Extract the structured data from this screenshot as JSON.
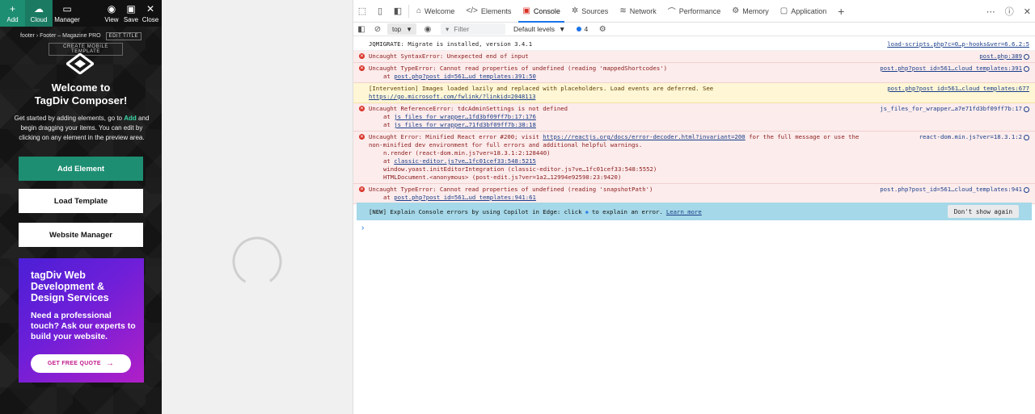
{
  "composer": {
    "toolbar": [
      {
        "label": "Add",
        "icon": "plus-icon"
      },
      {
        "label": "Cloud",
        "icon": "cloud-icon"
      },
      {
        "label": "Manager",
        "icon": "manager-icon"
      },
      {
        "label": "View",
        "icon": "eye-icon"
      },
      {
        "label": "Save",
        "icon": "save-icon"
      },
      {
        "label": "Close",
        "icon": "close-icon"
      }
    ],
    "breadcrumb_prefix": "footer",
    "breadcrumb_title": "Footer – Magazine PRO",
    "edit_title": "EDIT TITLE",
    "mobile_template": "CREATE MOBILE TEMPLATE",
    "welcome_line1": "Welcome to",
    "welcome_line2": "TagDiv Composer!",
    "intro_pre": "Get started by adding elements, go to",
    "intro_add": "Add",
    "intro_post": "and begin dragging your items. You can edit by clicking on any element in the preview area.",
    "add_element": "Add Element",
    "load_template": "Load Template",
    "website_manager": "Website Manager",
    "promo_title": "tagDiv Web Development & Design Services",
    "promo_sub": "Need a professional touch? Ask our experts to build your website.",
    "promo_button": "GET FREE QUOTE",
    "promo_arrow": "→",
    "accent": "#1e8e72"
  },
  "devtools": {
    "tabs": [
      {
        "label": "Welcome",
        "icon": "home-icon"
      },
      {
        "label": "Elements",
        "icon": "code-icon"
      },
      {
        "label": "Console",
        "icon": "console-icon"
      },
      {
        "label": "Sources",
        "icon": "bug-icon"
      },
      {
        "label": "Network",
        "icon": "wifi-icon"
      },
      {
        "label": "Performance",
        "icon": "performance-icon"
      },
      {
        "label": "Memory",
        "icon": "memory-icon"
      },
      {
        "label": "Application",
        "icon": "application-icon"
      }
    ],
    "active_tab": "Console",
    "context": "top",
    "filter_placeholder": "Filter",
    "levels": "Default levels",
    "issues_count": "4",
    "messages": [
      {
        "kind": "info",
        "text": "JQMIGRATE: Migrate is installed, version 3.4.1",
        "source": "load-scripts.php?c=0…p-hooks&ver=6.6.2:5"
      },
      {
        "kind": "err",
        "text": "Uncaught SyntaxError: Unexpected end of input",
        "source": "post.php:389"
      },
      {
        "kind": "err",
        "text": "Uncaught TypeError: Cannot read properties of undefined (reading 'mappedShortcodes')",
        "stack": [
          "post.php?post_id=561…ud_templates:391:50"
        ],
        "source": "post.php?post_id=561…cloud_templates:391"
      },
      {
        "kind": "warn",
        "text": "[Intervention] Images loaded lazily and replaced with placeholders. Load events are deferred. See",
        "link": "https://go.microsoft.com/fwlink/?linkid=2048113",
        "source": "post.php?post_id=561…cloud_templates:677"
      },
      {
        "kind": "err",
        "text": "Uncaught ReferenceError: tdcAdminSettings is not defined",
        "stack": [
          "js_files_for_wrapper…1fd3bf09ff7b:17:176",
          "js_files_for_wrapper…71fd3bf09ff7b:38:18"
        ],
        "source": "js_files_for_wrapper…a7e71fd3bf09ff7b:17"
      },
      {
        "kind": "err",
        "text": "Uncaught Error: Minified React error #200; visit",
        "link": "https://reactjs.org/docs/error-decoder.html?invariant=200",
        "text2": "for the full message or use the non-minified dev environment for full errors and additional helpful warnings.",
        "stack": [
          "n.render (react-dom.min.js?ver=18.3.1:2:128440)",
          "classic-editor.js?ve…1fc01cef33:548:5215",
          "window.yoast.initEditorIntegration (classic-editor.js?ve…1fc01cef33:548:5552)",
          "HTMLDocument.<anonymous> (post-edit.js?ver=1a2…12994e92598:23:9420)"
        ],
        "source": "react-dom.min.js?ver=18.3.1:2"
      },
      {
        "kind": "err",
        "text": "Uncaught TypeError: Cannot read properties of undefined (reading 'snapshotPath')",
        "stack": [
          "post.php?post_id=561…ud_templates:941:61"
        ],
        "source": "post.php?post_id=561…cloud_templates:941"
      }
    ],
    "copilot_text": "[NEW] Explain Console errors by using Copilot in Edge: click",
    "copilot_text2": "to explain an error.",
    "copilot_link": "Learn more",
    "dont_show": "Don't show again",
    "prompt": "›"
  }
}
